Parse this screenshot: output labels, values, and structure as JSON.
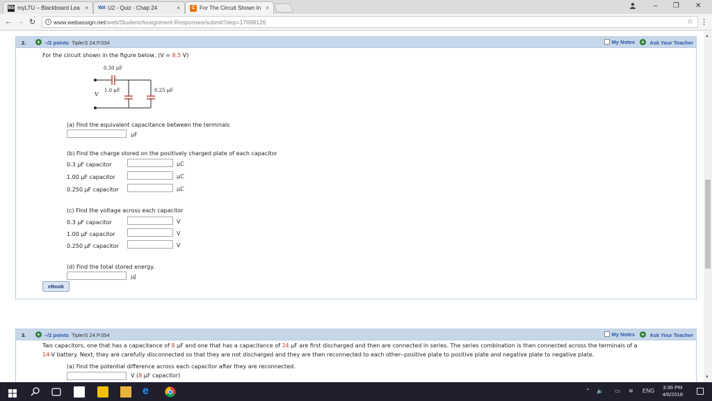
{
  "browser": {
    "tabs": [
      {
        "label": "myLTU – Blackboard Lea",
        "favicon": "Bb"
      },
      {
        "label": "U2 - Quiz - Chap 24",
        "favicon": "WA"
      },
      {
        "label": "For The Circuit Shown In",
        "favicon": "C"
      }
    ],
    "tab_close": "×",
    "url_host": "www.webassign.net",
    "url_path": "/web/Student/Assignment-Responses/submit?dep=17698126",
    "win_controls": {
      "minimize": "–",
      "maximize": "❐",
      "close": "✕"
    }
  },
  "question2": {
    "number": "2.",
    "points": "–/2 points",
    "reference": "TiplerS 24.P.034",
    "my_notes": "My Notes",
    "ask_teacher": "Ask Your Teacher",
    "prompt_pre": "For the circuit shown in the figure below, (V = ",
    "voltage": "8.5",
    "prompt_post": " V)",
    "figure": {
      "c_top": "0.30 μF",
      "c_left": "1.0 μF",
      "c_right": "0.25 μF",
      "v_label": "V"
    },
    "part_a": {
      "label": "(a) Find the equivalent capacitance between the terminals",
      "unit": "μF"
    },
    "part_b": {
      "label": "(b) Find the charge stored on the positively charged plate of each capacitor",
      "rows": [
        {
          "label": "0.3 μF capacitor",
          "unit": "μC"
        },
        {
          "label": "1.00 μF capacitor",
          "unit": "μC"
        },
        {
          "label": "0.250 μF capacitor",
          "unit": "μC"
        }
      ]
    },
    "part_c": {
      "label": "(c) Find the voltage across each capacitor",
      "rows": [
        {
          "label": "0.3 μF capacitor",
          "unit": "V"
        },
        {
          "label": "1.00 μF capacitor",
          "unit": "V"
        },
        {
          "label": "0.250 μF capacitor",
          "unit": "V"
        }
      ]
    },
    "part_d": {
      "label": "(d) Find the total stored energy.",
      "unit": "μJ"
    },
    "ebook": "eBook"
  },
  "question3": {
    "number": "3.",
    "points": "–/2 points",
    "reference": "TiplerS 24.P.054",
    "my_notes": "My Notes",
    "ask_teacher": "Ask Your Teacher",
    "line1_a": "Two capacitors, one that has a capacitance of ",
    "c1": "8",
    "line1_b": " μF and one that has a capacitance of ",
    "c2": "24",
    "line1_c": " μF are first discharged and then are connected in series. The series combination is then connected across the terminals of a",
    "line2_v": "14",
    "line2_rest": "-V battery. Next, they are carefully disconnected so that they are not discharged and they are then reconnected to each other--positive plate to positive plate and negative plate to negative plate.",
    "part_a": "(a) Find the potential difference across each capacitor after they are reconnected.",
    "sub_pre": "V (",
    "sub_c": "8",
    "sub_post": " μF capacitor)"
  },
  "taskbar": {
    "lang": "ENG",
    "time": "3:36 PM",
    "date": "4/6/2018"
  }
}
